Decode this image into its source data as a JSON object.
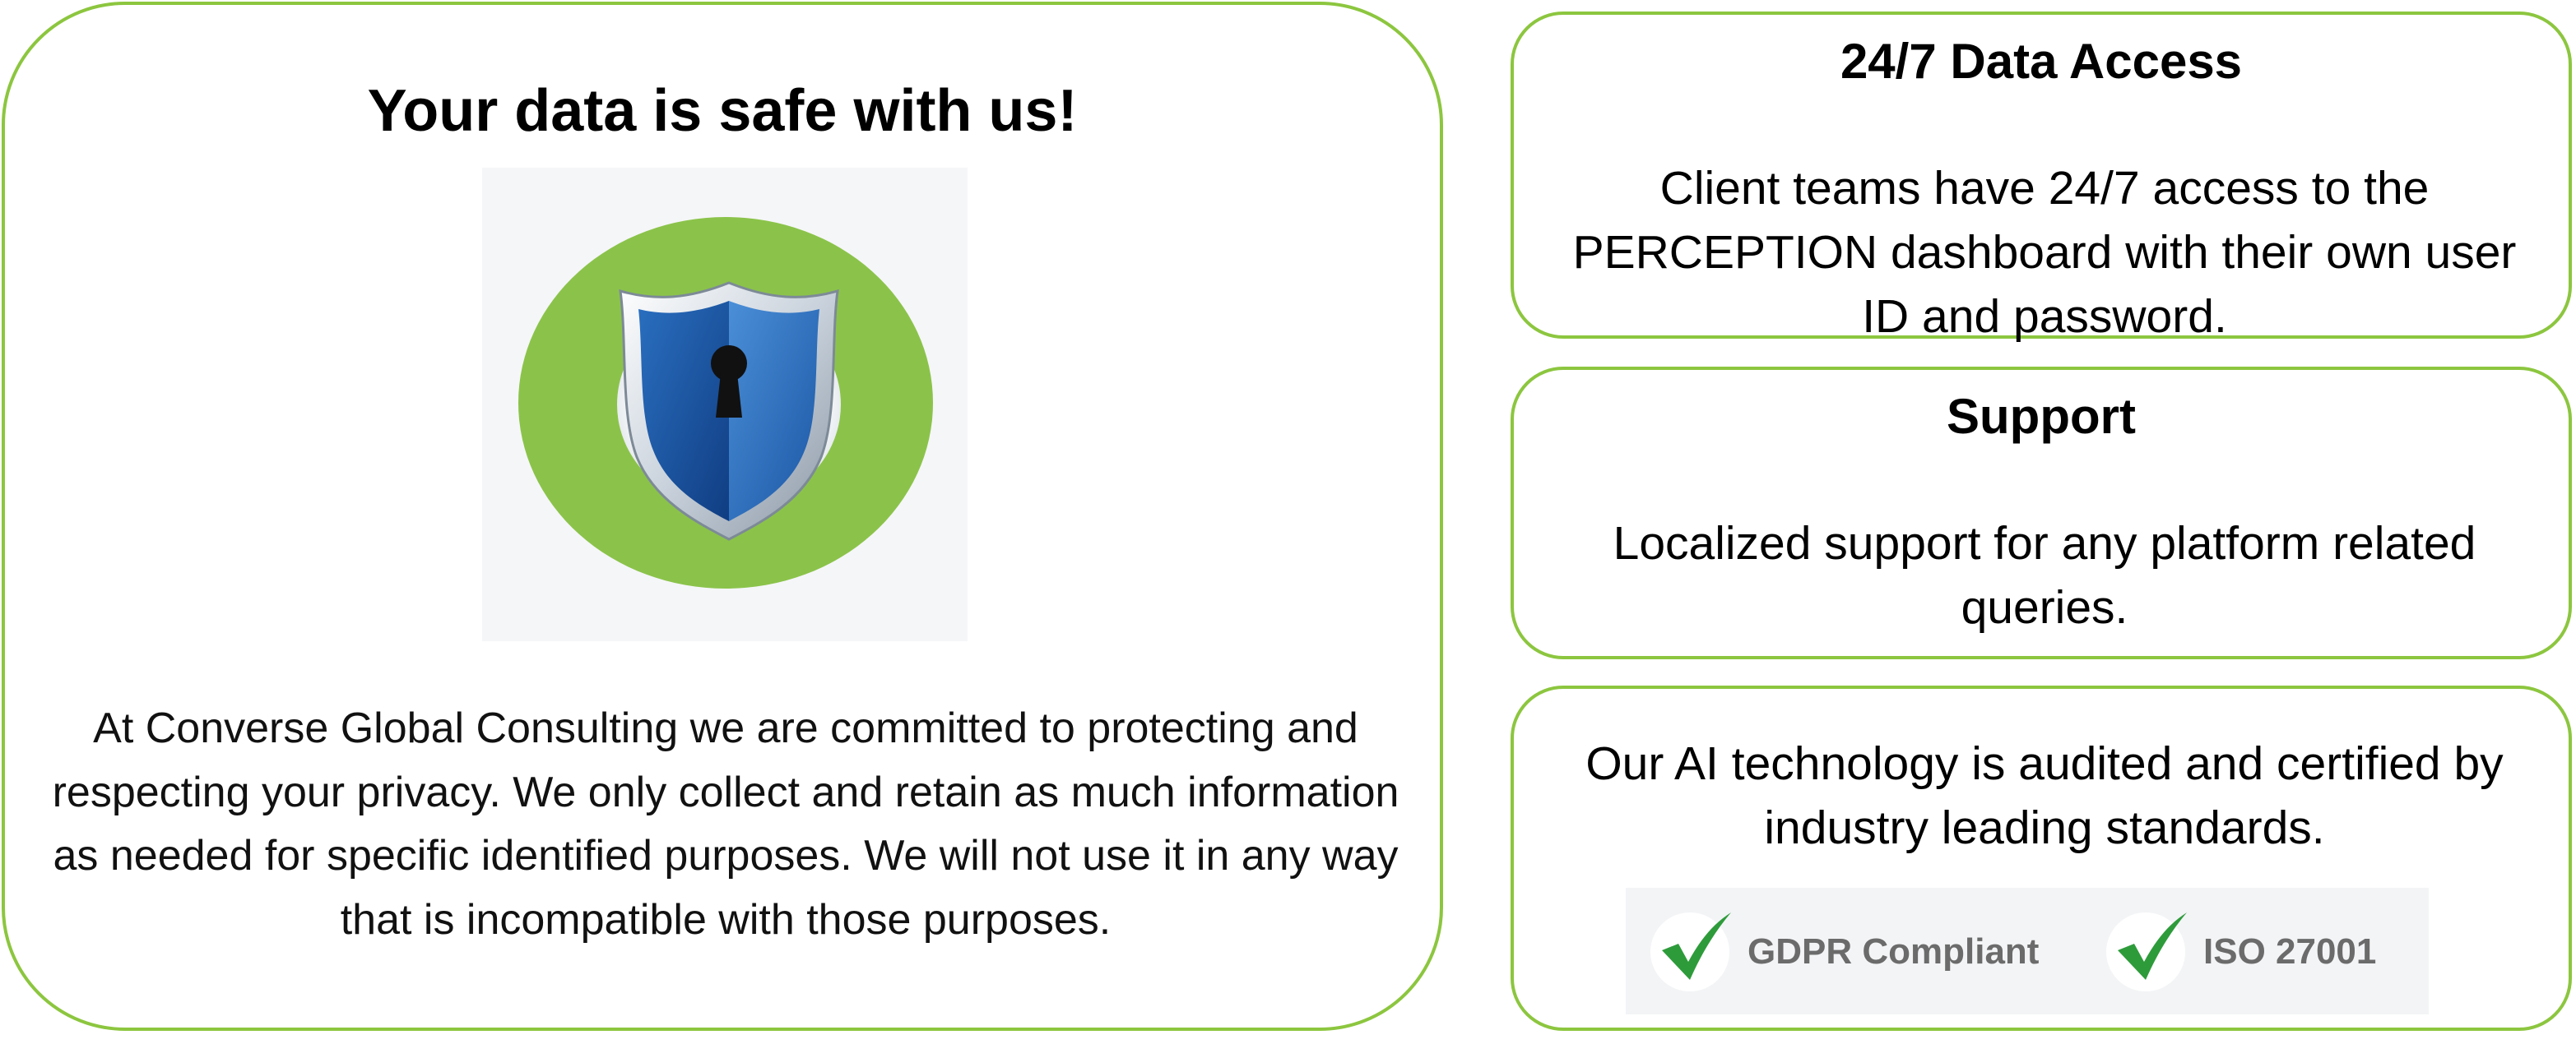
{
  "left_card": {
    "title": "Your data is safe with us!",
    "image_icon": "shield-keyhole-icon",
    "body": "At Converse Global Consulting we are committed to protecting and respecting your privacy. We only collect and retain as much information as needed for specific identified purposes. We will not use it in any way that is incompatible with those purposes."
  },
  "access_card": {
    "title": "24/7 Data Access",
    "body": "Client teams have 24/7 access to the PERCEPTION dashboard with their own user ID and password."
  },
  "support_card": {
    "title": "Support",
    "body": "Localized support for any platform related queries."
  },
  "tech_card": {
    "body": "Our AI technology is audited and certified by industry leading standards.",
    "certifications": [
      {
        "icon": "checkmark-icon",
        "label": "GDPR Compliant"
      },
      {
        "icon": "checkmark-icon",
        "label": "ISO 27001"
      }
    ]
  },
  "colors": {
    "border_green": "#8cc63f",
    "circle_green": "#8bc34a",
    "check_green": "#2e9b3b",
    "shield_blue": "#1f5fa8",
    "cert_text": "#6b6b6b"
  }
}
